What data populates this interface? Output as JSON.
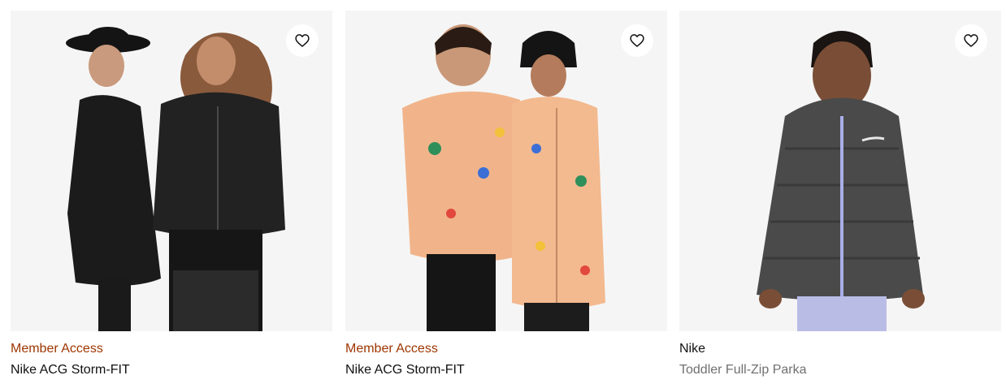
{
  "colors": {
    "badge": "#9e3500",
    "title": "#111111",
    "subtitle": "#707072",
    "image_bg": "#f5f5f5"
  },
  "products": [
    {
      "badge": "Member Access",
      "title": "Nike ACG Storm-FIT",
      "favorite_icon": "heart-outline-icon",
      "image": "two kids in black ACG jackets"
    },
    {
      "badge": "Member Access",
      "title": "Nike ACG Storm-FIT",
      "favorite_icon": "heart-outline-icon",
      "image": "two kids in peach printed jackets"
    },
    {
      "brand": "Nike",
      "subtitle": "Toddler Full-Zip Parka",
      "favorite_icon": "heart-outline-icon",
      "image": "toddler in grey puffer parka"
    }
  ]
}
